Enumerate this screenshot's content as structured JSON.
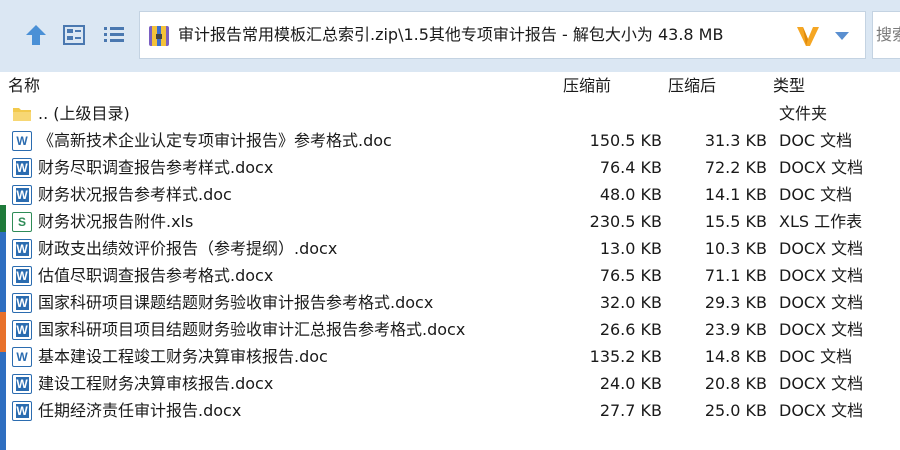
{
  "toolbar": {
    "up_icon": "arrow-up-icon",
    "view_icon": "view-mode-icon",
    "list_icon": "list-icon",
    "address": "审计报告常用模板汇总索引.zip\\1.5其他专项审计报告 - 解包大小为 43.8 MB",
    "address_icon": "archive-icon",
    "logo_icon": "v-logo-icon",
    "dropdown_icon": "chevron-down-icon",
    "search_placeholder": "搜索"
  },
  "columns": {
    "name": "名称",
    "packed": "压缩前",
    "original": "压缩后",
    "type": "类型"
  },
  "rows": [
    {
      "icon": "folder-icon",
      "name": ".. (上级目录)",
      "packed": "",
      "original": "",
      "type": "文件夹"
    },
    {
      "icon": "doc-icon",
      "name": "《高新技术企业认定专项审计报告》参考格式.doc",
      "packed": "150.5 KB",
      "original": "31.3 KB",
      "type": "DOC 文档"
    },
    {
      "icon": "word-icon",
      "name": "财务尽职调查报告参考样式.docx",
      "packed": "76.4 KB",
      "original": "72.2 KB",
      "type": "DOCX 文档"
    },
    {
      "icon": "word-icon",
      "name": "财务状况报告参考样式.doc",
      "packed": "48.0 KB",
      "original": "14.1 KB",
      "type": "DOC 文档"
    },
    {
      "icon": "excel-icon",
      "name": "财务状况报告附件.xls",
      "packed": "230.5 KB",
      "original": "15.5 KB",
      "type": "XLS 工作表"
    },
    {
      "icon": "word-icon",
      "name": "财政支出绩效评价报告（参考提纲）.docx",
      "packed": "13.0 KB",
      "original": "10.3 KB",
      "type": "DOCX 文档"
    },
    {
      "icon": "word-icon",
      "name": "估值尽职调查报告参考格式.docx",
      "packed": "76.5 KB",
      "original": "71.1 KB",
      "type": "DOCX 文档"
    },
    {
      "icon": "word-icon",
      "name": "国家科研项目课题结题财务验收审计报告参考格式.docx",
      "packed": "32.0 KB",
      "original": "29.3 KB",
      "type": "DOCX 文档"
    },
    {
      "icon": "word-icon",
      "name": "国家科研项目项目结题财务验收审计汇总报告参考格式.docx",
      "packed": "26.6 KB",
      "original": "23.9 KB",
      "type": "DOCX 文档"
    },
    {
      "icon": "doc-icon",
      "name": "基本建设工程竣工财务决算审核报告.doc",
      "packed": "135.2 KB",
      "original": "14.8 KB",
      "type": "DOC 文档"
    },
    {
      "icon": "word-icon",
      "name": "建设工程财务决算审核报告.docx",
      "packed": "24.0 KB",
      "original": "20.8 KB",
      "type": "DOCX 文档"
    },
    {
      "icon": "word-icon",
      "name": "任期经济责任审计报告.docx",
      "packed": "27.7 KB",
      "original": "25.0 KB",
      "type": "DOCX 文档"
    }
  ]
}
